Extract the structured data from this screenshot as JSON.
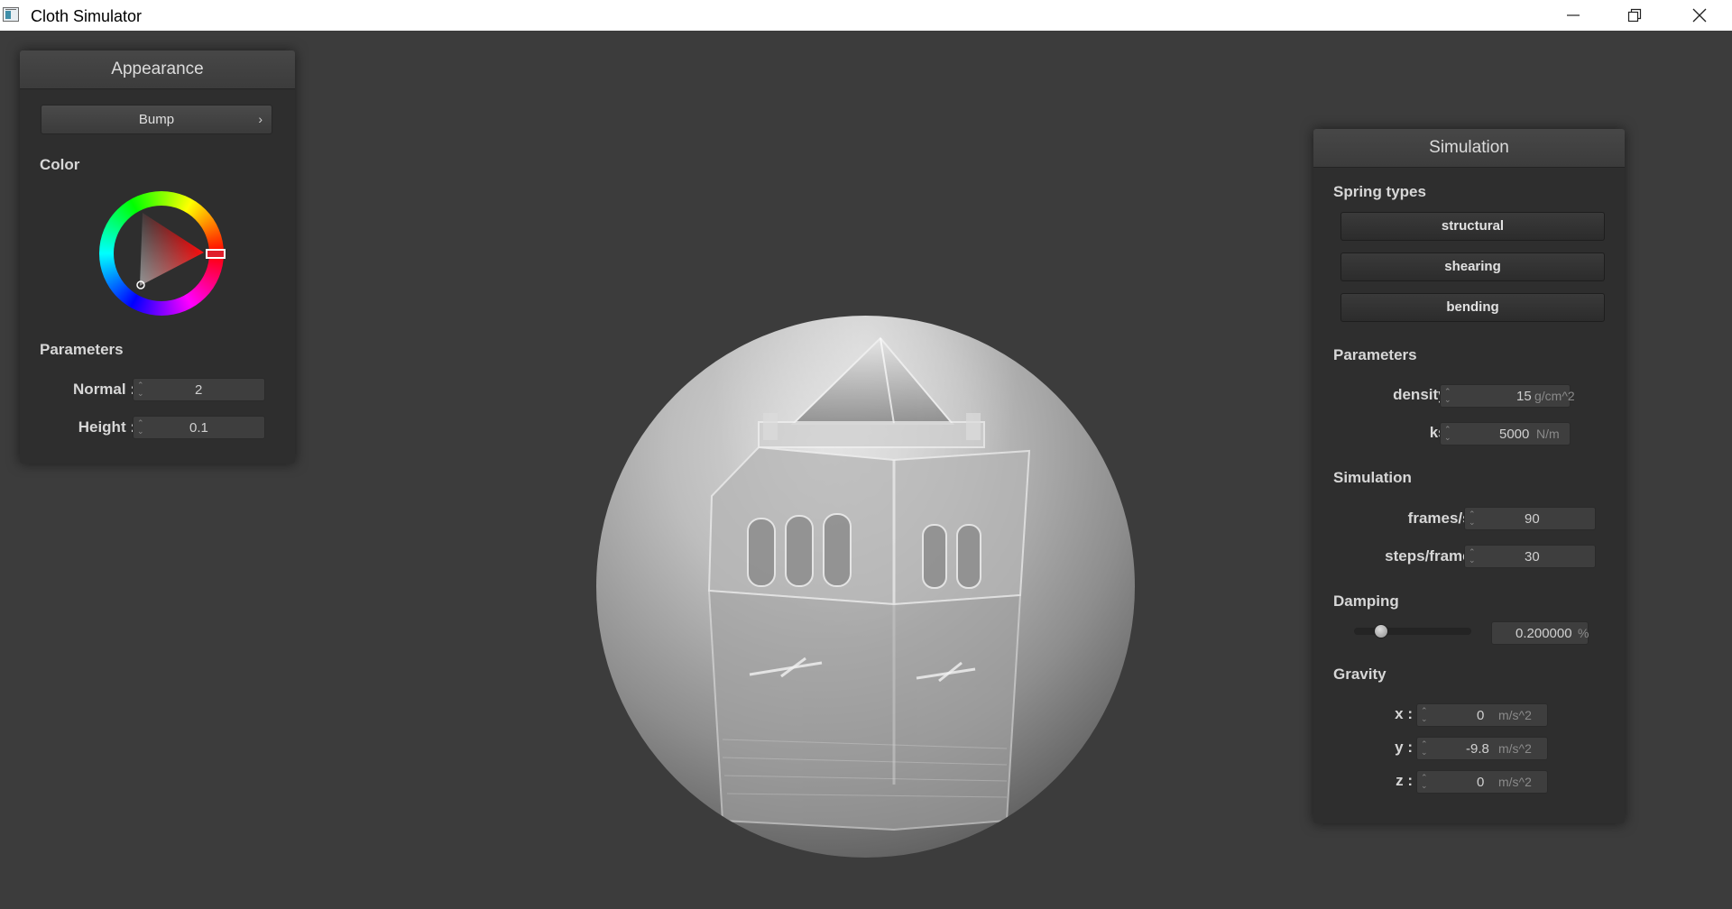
{
  "window": {
    "title": "Cloth Simulator",
    "icon": "app-window-icon",
    "controls": [
      "minimize-icon",
      "restore-icon",
      "close-icon"
    ]
  },
  "appearance": {
    "title": "Appearance",
    "shader": {
      "selected": "Bump",
      "icon": "chevron-right-icon"
    },
    "color_label": "Color",
    "color": {
      "hue": "#ff0000",
      "selected": "#e01d2a"
    },
    "params_label": "Parameters",
    "params": [
      {
        "label": "Normal :",
        "value": "2"
      },
      {
        "label": "Height :",
        "value": "0.1"
      }
    ]
  },
  "simulation": {
    "title": "Simulation",
    "spring_label": "Spring types",
    "springs": [
      "structural",
      "shearing",
      "bending"
    ],
    "params_label": "Parameters",
    "params": [
      {
        "label": "density :",
        "value": "15",
        "unit": "g/cm^2"
      },
      {
        "label": "ks :",
        "value": "5000",
        "unit": "N/m"
      }
    ],
    "sim_label": "Simulation",
    "sim": [
      {
        "label": "frames/s :",
        "value": "90"
      },
      {
        "label": "steps/frame :",
        "value": "30"
      }
    ],
    "damping_label": "Damping",
    "damping": {
      "value": "0.200000",
      "unit": "%",
      "slider_fraction": 0.2
    },
    "gravity_label": "Gravity",
    "gravity": [
      {
        "label": "x :",
        "value": "0",
        "unit": "m/s^2"
      },
      {
        "label": "y :",
        "value": "-9.8",
        "unit": "m/s^2"
      },
      {
        "label": "z :",
        "value": "0",
        "unit": "m/s^2"
      }
    ]
  }
}
